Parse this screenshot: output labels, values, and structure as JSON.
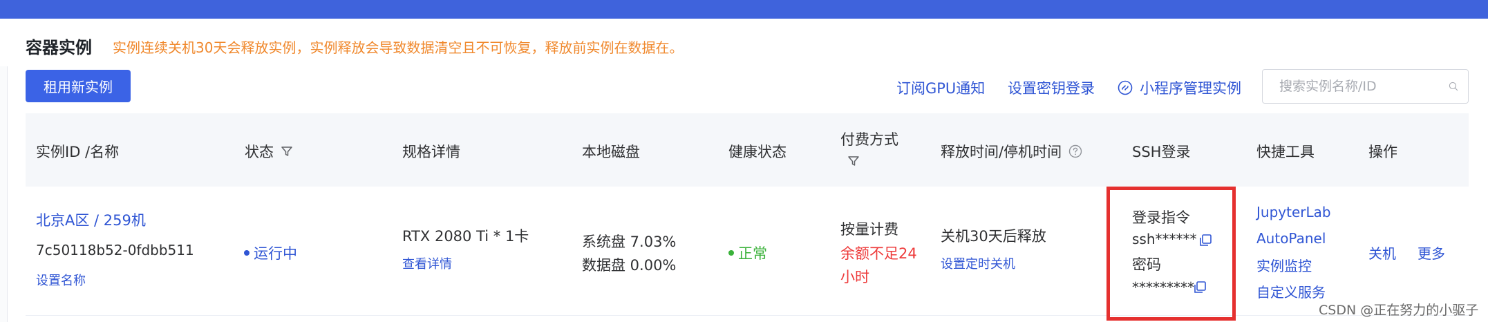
{
  "header": {
    "title": "容器实例",
    "warning": "实例连续关机30天会释放实例，实例释放会导致数据清空且不可恢复，释放前实例在数据在。"
  },
  "toolbar": {
    "rent_button": "租用新实例",
    "subscribe_gpu": "订阅GPU通知",
    "set_key_login": "设置密钥登录",
    "miniprogram": "小程序管理实例",
    "search_placeholder": "搜索实例名称/ID"
  },
  "table": {
    "columns": {
      "instance": "实例ID /名称",
      "status": "状态",
      "spec": "规格详情",
      "disk": "本地磁盘",
      "health": "健康状态",
      "billing_line1": "付费方式",
      "release": "释放时间/停机时间",
      "ssh": "SSH登录",
      "tools": "快捷工具",
      "actions": "操作"
    },
    "row": {
      "region": "北京A区 / 259机",
      "id": "7c50118b52-0fdbb511",
      "set_name": "设置名称",
      "status": "运行中",
      "spec": "RTX 2080 Ti * 1卡",
      "view_details": "查看详情",
      "system_disk": "系统盘 7.03%",
      "data_disk": "数据盘 0.00%",
      "health": "正常",
      "billing": "按量计费",
      "balance_warning_1": "余额不足24",
      "balance_warning_2": "小时",
      "release_text": "关机30天后释放",
      "set_timed_shutdown": "设置定时关机",
      "login_cmd_label": "登录指令",
      "ssh_cmd": "ssh******",
      "password_label": "密码",
      "password": "*********",
      "tools": [
        "JupyterLab",
        "AutoPanel",
        "实例监控",
        "自定义服务"
      ],
      "shutdown": "关机",
      "more": "更多"
    }
  },
  "watermark": "CSDN @正在努力的小驱子",
  "colors": {
    "topbar": "#3f63dc",
    "primary": "#3b63e6",
    "link": "#2f55d4",
    "warning": "#f0892e",
    "danger": "#ee3b3b",
    "success": "#3ab23a",
    "highlight_border": "#e5302f"
  },
  "icons": {
    "status_filter": "filter-icon",
    "billing_filter": "filter-icon",
    "release_help": "help-circle-icon",
    "search": "search-icon",
    "miniprogram": "miniprogram-icon",
    "copy": "copy-icon"
  }
}
